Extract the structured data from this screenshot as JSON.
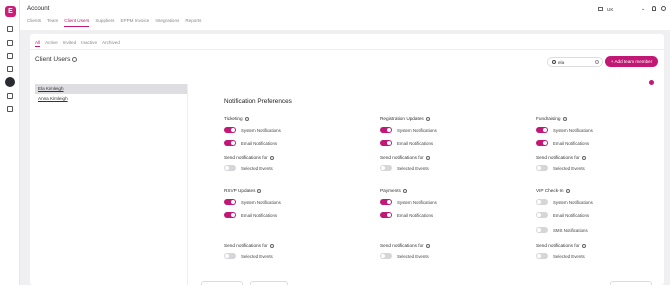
{
  "app": {
    "logo": "E",
    "title": "Account"
  },
  "tabs": [
    {
      "label": "Clients"
    },
    {
      "label": "Team"
    },
    {
      "label": "Client Users"
    },
    {
      "label": "Suppliers"
    },
    {
      "label": "EPPM Invoice"
    },
    {
      "label": "Integrations"
    },
    {
      "label": "Reports"
    }
  ],
  "header": {
    "lang": "UK"
  },
  "subtabs": [
    {
      "label": "All"
    },
    {
      "label": "Active"
    },
    {
      "label": "Invited"
    },
    {
      "label": "Inactive"
    },
    {
      "label": "Archived"
    }
  ],
  "page": {
    "title": "Client Users",
    "search_value": "ela",
    "add_button": "Add team member"
  },
  "users": [
    {
      "name": "Ela Kimleigh"
    },
    {
      "name": "Anna Kimleigh"
    }
  ],
  "prefs": {
    "title": "Notification Preferences",
    "system": "System Notifications",
    "email": "Email Notifications",
    "sms": "SMS Notifications",
    "send_for": "Send notifications for",
    "selected": "Selected Events"
  },
  "sections": [
    {
      "title": "Ticketing"
    },
    {
      "title": "Registration Updates"
    },
    {
      "title": "Fundraising"
    },
    {
      "title": "RSVP Updates"
    },
    {
      "title": "Payments"
    },
    {
      "title": "VIP Check-In"
    }
  ],
  "colors": {
    "accent": "#c21875"
  }
}
